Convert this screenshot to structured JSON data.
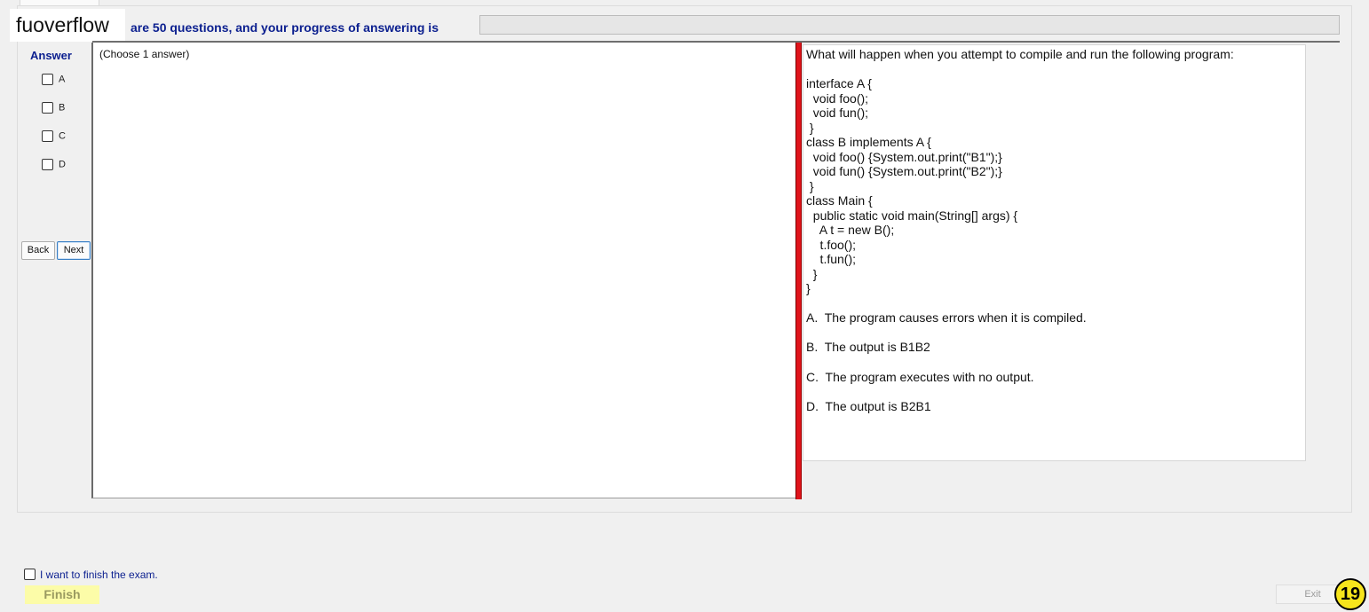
{
  "header": {
    "watermark": "fuoverflow",
    "progress_text": "are 50 questions, and your progress of answering is"
  },
  "answer_panel": {
    "title": "Answer",
    "options": [
      "A",
      "B",
      "C",
      "D"
    ],
    "back_label": "Back",
    "next_label": "Next"
  },
  "left_pane": {
    "instruction": "(Choose 1 answer)"
  },
  "question": {
    "prompt": "What will happen when you attempt to compile and run the following program:",
    "code": [
      "interface A {",
      "  void foo();",
      "  void fun();",
      " }",
      "class B implements A {",
      "  void foo() {System.out.print(\"B1\");}",
      "  void fun() {System.out.print(\"B2\");}",
      " }",
      "class Main {",
      "  public static void main(String[] args) {",
      "    A t = new B();",
      "    t.foo();",
      "    t.fun();",
      "  }",
      "}"
    ],
    "options": [
      "A.  The program causes errors when it is compiled.",
      "B.  The output is B1B2",
      "C.  The program executes with no output.",
      "D.  The output is B2B1"
    ]
  },
  "footer": {
    "finish_checkbox_label": "I want to finish the exam.",
    "finish_label": "Finish",
    "exit_label": "Exit",
    "badge": "19"
  }
}
